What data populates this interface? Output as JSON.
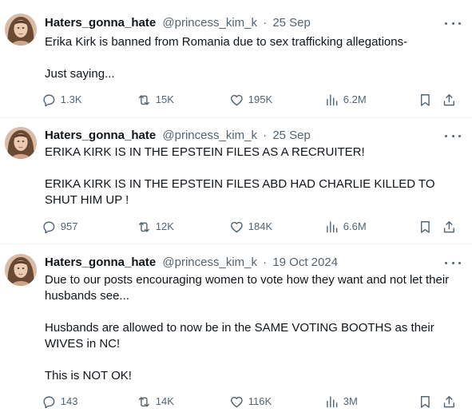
{
  "tweets": [
    {
      "name": "Haters_gonna_hate",
      "handle": "@princess_kim_k",
      "separator": "·",
      "date": "25 Sep",
      "lines": [
        "Erika Kirk is banned from Romania due to sex trafficking allegations-",
        "Just saying..."
      ],
      "replies": "1.3K",
      "reposts": "15K",
      "likes": "195K",
      "views": "6.2M"
    },
    {
      "name": "Haters_gonna_hate",
      "handle": "@princess_kim_k",
      "separator": "·",
      "date": "25 Sep",
      "lines": [
        "ERIKA KIRK IS IN THE EPSTEIN FILES AS A RECRUITER!",
        "ERIKA KIRK IS IN THE EPSTEIN FILES ABD HAD CHARLIE KILLED TO SHUT HIM UP !"
      ],
      "replies": "957",
      "reposts": "12K",
      "likes": "184K",
      "views": "6.6M"
    },
    {
      "name": "Haters_gonna_hate",
      "handle": "@princess_kim_k",
      "separator": "·",
      "date": "19 Oct 2024",
      "lines": [
        "Due to our posts encouraging women to vote how they want and not let their husbands see...",
        "Husbands are allowed to now be in the SAME VOTING BOOTHS as their WIVES in NC!",
        "This is NOT OK!"
      ],
      "replies": "143",
      "reposts": "14K",
      "likes": "116K",
      "views": "3M"
    }
  ],
  "icons": {
    "reply": "reply-icon",
    "repost": "repost-icon",
    "like": "heart-icon",
    "views": "views-icon",
    "bookmark": "bookmark-icon",
    "share": "share-icon",
    "more": "more-icon"
  }
}
